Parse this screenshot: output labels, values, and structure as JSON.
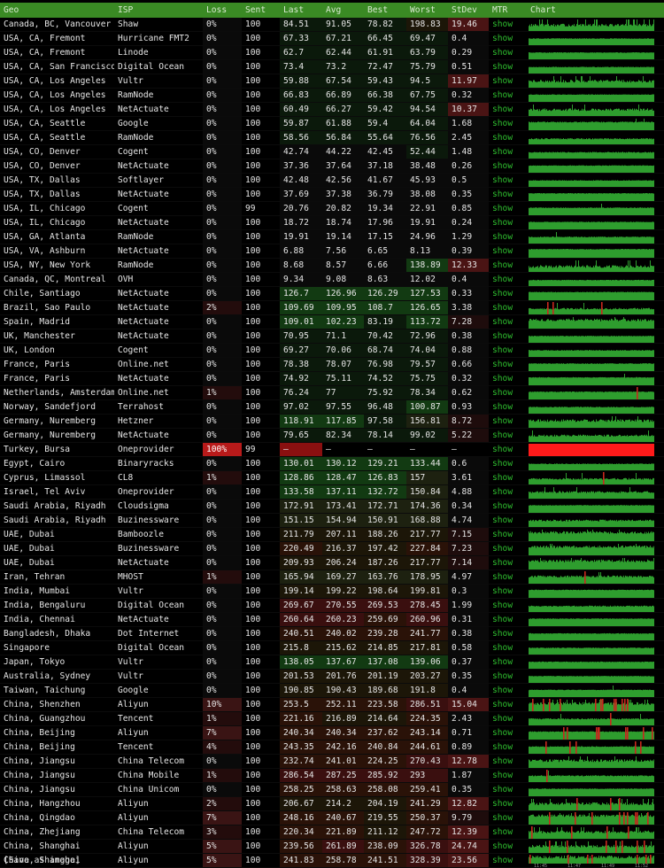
{
  "headers": [
    "Geo",
    "ISP",
    "Loss",
    "Sent",
    "Last",
    "Avg",
    "Best",
    "Worst",
    "StDev",
    "MTR",
    "Chart"
  ],
  "rows": [
    [
      "Canada, BC, Vancouver",
      "Shaw",
      "0%",
      "100",
      "84.51",
      "91.05",
      "78.82",
      "198.83",
      "19.46",
      "show"
    ],
    [
      "USA, CA, Fremont",
      "Hurricane FMT2",
      "0%",
      "100",
      "67.33",
      "67.21",
      "66.45",
      "69.47",
      "0.4",
      "show"
    ],
    [
      "USA, CA, Fremont",
      "Linode",
      "0%",
      "100",
      "62.7",
      "62.44",
      "61.91",
      "63.79",
      "0.29",
      "show"
    ],
    [
      "USA, CA, San Francisco",
      "Digital Ocean",
      "0%",
      "100",
      "73.4",
      "73.2",
      "72.47",
      "75.79",
      "0.51",
      "show"
    ],
    [
      "USA, CA, Los Angeles",
      "Vultr",
      "0%",
      "100",
      "59.88",
      "67.54",
      "59.43",
      "94.5",
      "11.97",
      "show"
    ],
    [
      "USA, CA, Los Angeles",
      "RamNode",
      "0%",
      "100",
      "66.83",
      "66.89",
      "66.38",
      "67.75",
      "0.32",
      "show"
    ],
    [
      "USA, CA, Los Angeles",
      "NetActuate",
      "0%",
      "100",
      "60.49",
      "66.27",
      "59.42",
      "94.54",
      "10.37",
      "show"
    ],
    [
      "USA, CA, Seattle",
      "Google",
      "0%",
      "100",
      "59.87",
      "61.88",
      "59.4",
      "64.04",
      "1.68",
      "show"
    ],
    [
      "USA, CA, Seattle",
      "RamNode",
      "0%",
      "100",
      "58.56",
      "56.84",
      "55.64",
      "76.56",
      "2.45",
      "show"
    ],
    [
      "USA, CO, Denver",
      "Cogent",
      "0%",
      "100",
      "42.74",
      "44.22",
      "42.45",
      "52.44",
      "1.48",
      "show"
    ],
    [
      "USA, CO, Denver",
      "NetActuate",
      "0%",
      "100",
      "37.36",
      "37.64",
      "37.18",
      "38.48",
      "0.26",
      "show"
    ],
    [
      "USA, TX, Dallas",
      "Softlayer",
      "0%",
      "100",
      "42.48",
      "42.56",
      "41.67",
      "45.93",
      "0.5",
      "show"
    ],
    [
      "USA, TX, Dallas",
      "NetActuate",
      "0%",
      "100",
      "37.69",
      "37.38",
      "36.79",
      "38.08",
      "0.35",
      "show"
    ],
    [
      "USA, IL, Chicago",
      "Cogent",
      "0%",
      "99",
      "20.76",
      "20.82",
      "19.34",
      "22.91",
      "0.85",
      "show"
    ],
    [
      "USA, IL, Chicago",
      "NetActuate",
      "0%",
      "100",
      "18.72",
      "18.74",
      "17.96",
      "19.91",
      "0.24",
      "show"
    ],
    [
      "USA, GA, Atlanta",
      "RamNode",
      "0%",
      "100",
      "19.91",
      "19.14",
      "17.15",
      "24.96",
      "1.29",
      "show"
    ],
    [
      "USA, VA, Ashburn",
      "NetActuate",
      "0%",
      "100",
      "6.88",
      "7.56",
      "6.65",
      "8.13",
      "0.39",
      "show"
    ],
    [
      "USA, NY, New York",
      "RamNode",
      "0%",
      "100",
      "8.68",
      "8.57",
      "6.66",
      "138.89",
      "12.33",
      "show"
    ],
    [
      "Canada, QC, Montreal",
      "OVH",
      "0%",
      "100",
      "9.34",
      "9.08",
      "8.63",
      "12.02",
      "0.4",
      "show"
    ],
    [
      "Chile, Santiago",
      "NetActuate",
      "0%",
      "100",
      "126.7",
      "126.96",
      "126.29",
      "127.53",
      "0.33",
      "show"
    ],
    [
      "Brazil, Sao Paulo",
      "NetActuate",
      "2%",
      "100",
      "109.69",
      "109.95",
      "108.7",
      "126.65",
      "3.38",
      "show"
    ],
    [
      "Spain, Madrid",
      "NetActuate",
      "0%",
      "100",
      "109.01",
      "102.23",
      "83.19",
      "113.72",
      "7.28",
      "show"
    ],
    [
      "UK, Manchester",
      "NetActuate",
      "0%",
      "100",
      "70.95",
      "71.1",
      "70.42",
      "72.96",
      "0.38",
      "show"
    ],
    [
      "UK, London",
      "Cogent",
      "0%",
      "100",
      "69.27",
      "70.06",
      "68.74",
      "74.04",
      "0.88",
      "show"
    ],
    [
      "France, Paris",
      "Online.net",
      "0%",
      "100",
      "78.38",
      "78.07",
      "76.98",
      "79.57",
      "0.66",
      "show"
    ],
    [
      "France, Paris",
      "NetActuate",
      "0%",
      "100",
      "74.92",
      "75.11",
      "74.52",
      "75.75",
      "0.32",
      "show"
    ],
    [
      "Netherlands, Amsterdam",
      "Online.net",
      "1%",
      "100",
      "76.24",
      "77",
      "75.92",
      "78.34",
      "0.62",
      "show"
    ],
    [
      "Norway, Sandefjord",
      "Terrahost",
      "0%",
      "100",
      "97.02",
      "97.55",
      "96.48",
      "100.87",
      "0.93",
      "show"
    ],
    [
      "Germany, Nuremberg",
      "Hetzner",
      "0%",
      "100",
      "118.91",
      "117.85",
      "97.58",
      "156.81",
      "8.72",
      "show"
    ],
    [
      "Germany, Nuremberg",
      "NetActuate",
      "0%",
      "100",
      "79.65",
      "82.34",
      "78.14",
      "99.02",
      "5.22",
      "show"
    ],
    [
      "Turkey, Bursa",
      "Oneprovider",
      "100%",
      "99",
      "–",
      "–",
      "–",
      "–",
      "–",
      "show"
    ],
    [
      "Egypt, Cairo",
      "Binaryracks",
      "0%",
      "100",
      "130.01",
      "130.12",
      "129.21",
      "133.44",
      "0.6",
      "show"
    ],
    [
      "Cyprus, Limassol",
      "CL8",
      "1%",
      "100",
      "128.86",
      "128.47",
      "126.83",
      "157",
      "3.61",
      "show"
    ],
    [
      "Israel, Tel Aviv",
      "Oneprovider",
      "0%",
      "100",
      "133.58",
      "137.11",
      "132.72",
      "150.84",
      "4.88",
      "show"
    ],
    [
      "Saudi Arabia, Riyadh",
      "Cloudsigma",
      "0%",
      "100",
      "172.91",
      "173.41",
      "172.71",
      "174.36",
      "0.34",
      "show"
    ],
    [
      "Saudi Arabia, Riyadh",
      "Buzinessware",
      "0%",
      "100",
      "151.15",
      "154.94",
      "150.91",
      "168.88",
      "4.74",
      "show"
    ],
    [
      "UAE, Dubai",
      "Bamboozle",
      "0%",
      "100",
      "211.79",
      "207.11",
      "188.26",
      "217.77",
      "7.15",
      "show"
    ],
    [
      "UAE, Dubai",
      "Buzinessware",
      "0%",
      "100",
      "220.49",
      "216.37",
      "197.42",
      "227.84",
      "7.23",
      "show"
    ],
    [
      "UAE, Dubai",
      "NetActuate",
      "0%",
      "100",
      "209.93",
      "206.24",
      "187.26",
      "217.77",
      "7.14",
      "show"
    ],
    [
      "Iran, Tehran",
      "MHOST",
      "1%",
      "100",
      "165.94",
      "169.27",
      "163.76",
      "178.95",
      "4.97",
      "show"
    ],
    [
      "India, Mumbai",
      "Vultr",
      "0%",
      "100",
      "199.14",
      "199.22",
      "198.64",
      "199.81",
      "0.3",
      "show"
    ],
    [
      "India, Bengaluru",
      "Digital Ocean",
      "0%",
      "100",
      "269.67",
      "270.55",
      "269.53",
      "278.45",
      "1.99",
      "show"
    ],
    [
      "India, Chennai",
      "NetActuate",
      "0%",
      "100",
      "260.64",
      "260.23",
      "259.69",
      "260.96",
      "0.31",
      "show"
    ],
    [
      "Bangladesh, Dhaka",
      "Dot Internet",
      "0%",
      "100",
      "240.51",
      "240.02",
      "239.28",
      "241.77",
      "0.38",
      "show"
    ],
    [
      "Singapore",
      "Digital Ocean",
      "0%",
      "100",
      "215.8",
      "215.62",
      "214.85",
      "217.81",
      "0.58",
      "show"
    ],
    [
      "Japan, Tokyo",
      "Vultr",
      "0%",
      "100",
      "138.05",
      "137.67",
      "137.08",
      "139.06",
      "0.37",
      "show"
    ],
    [
      "Australia, Sydney",
      "Vultr",
      "0%",
      "100",
      "201.53",
      "201.76",
      "201.19",
      "203.27",
      "0.35",
      "show"
    ],
    [
      "Taiwan, Taichung",
      "Google",
      "0%",
      "100",
      "190.85",
      "190.43",
      "189.68",
      "191.8",
      "0.4",
      "show"
    ],
    [
      "China, Shenzhen",
      "Aliyun",
      "10%",
      "100",
      "253.5",
      "252.11",
      "223.58",
      "286.51",
      "15.04",
      "show"
    ],
    [
      "China, Guangzhou",
      "Tencent",
      "1%",
      "100",
      "221.16",
      "216.89",
      "214.64",
      "224.35",
      "2.43",
      "show"
    ],
    [
      "China, Beijing",
      "Aliyun",
      "7%",
      "100",
      "240.34",
      "240.34",
      "237.62",
      "243.14",
      "0.71",
      "show"
    ],
    [
      "China, Beijing",
      "Tencent",
      "4%",
      "100",
      "243.35",
      "242.16",
      "240.84",
      "244.61",
      "0.89",
      "show"
    ],
    [
      "China, Jiangsu",
      "China Telecom",
      "0%",
      "100",
      "232.74",
      "241.01",
      "224.25",
      "270.43",
      "12.78",
      "show"
    ],
    [
      "China, Jiangsu",
      "China Mobile",
      "1%",
      "100",
      "286.54",
      "287.25",
      "285.92",
      "293",
      "1.87",
      "show"
    ],
    [
      "China, Jiangsu",
      "China Unicom",
      "0%",
      "100",
      "258.25",
      "258.63",
      "258.08",
      "259.41",
      "0.35",
      "show"
    ],
    [
      "China, Hangzhou",
      "Aliyun",
      "2%",
      "100",
      "206.67",
      "214.2",
      "204.19",
      "241.29",
      "12.82",
      "show"
    ],
    [
      "China, Qingdao",
      "Aliyun",
      "7%",
      "100",
      "248.16",
      "240.67",
      "219.55",
      "250.37",
      "9.79",
      "show"
    ],
    [
      "China, Zhejiang",
      "China Telecom",
      "3%",
      "100",
      "220.34",
      "221.89",
      "211.12",
      "247.72",
      "12.39",
      "show"
    ],
    [
      "China, Shanghai",
      "Aliyun",
      "5%",
      "100",
      "239.56",
      "261.89",
      "238.09",
      "326.78",
      "24.74",
      "show"
    ],
    [
      "China, Shanghai",
      "Aliyun",
      "5%",
      "100",
      "241.83",
      "258.78",
      "241.51",
      "328.39",
      "23.56",
      "show"
    ]
  ],
  "chart_axis_labels": [
    "11:45",
    "11:47",
    "11:49",
    "11:52"
  ],
  "save_label": "[Save as image]",
  "colors": {
    "header_bg": "#3a8a24",
    "bar_green": "#2e9d2e",
    "spike_red": "#c8281e",
    "full_loss_red": "#ff1a1a",
    "link_green": "#2fbf2f"
  }
}
